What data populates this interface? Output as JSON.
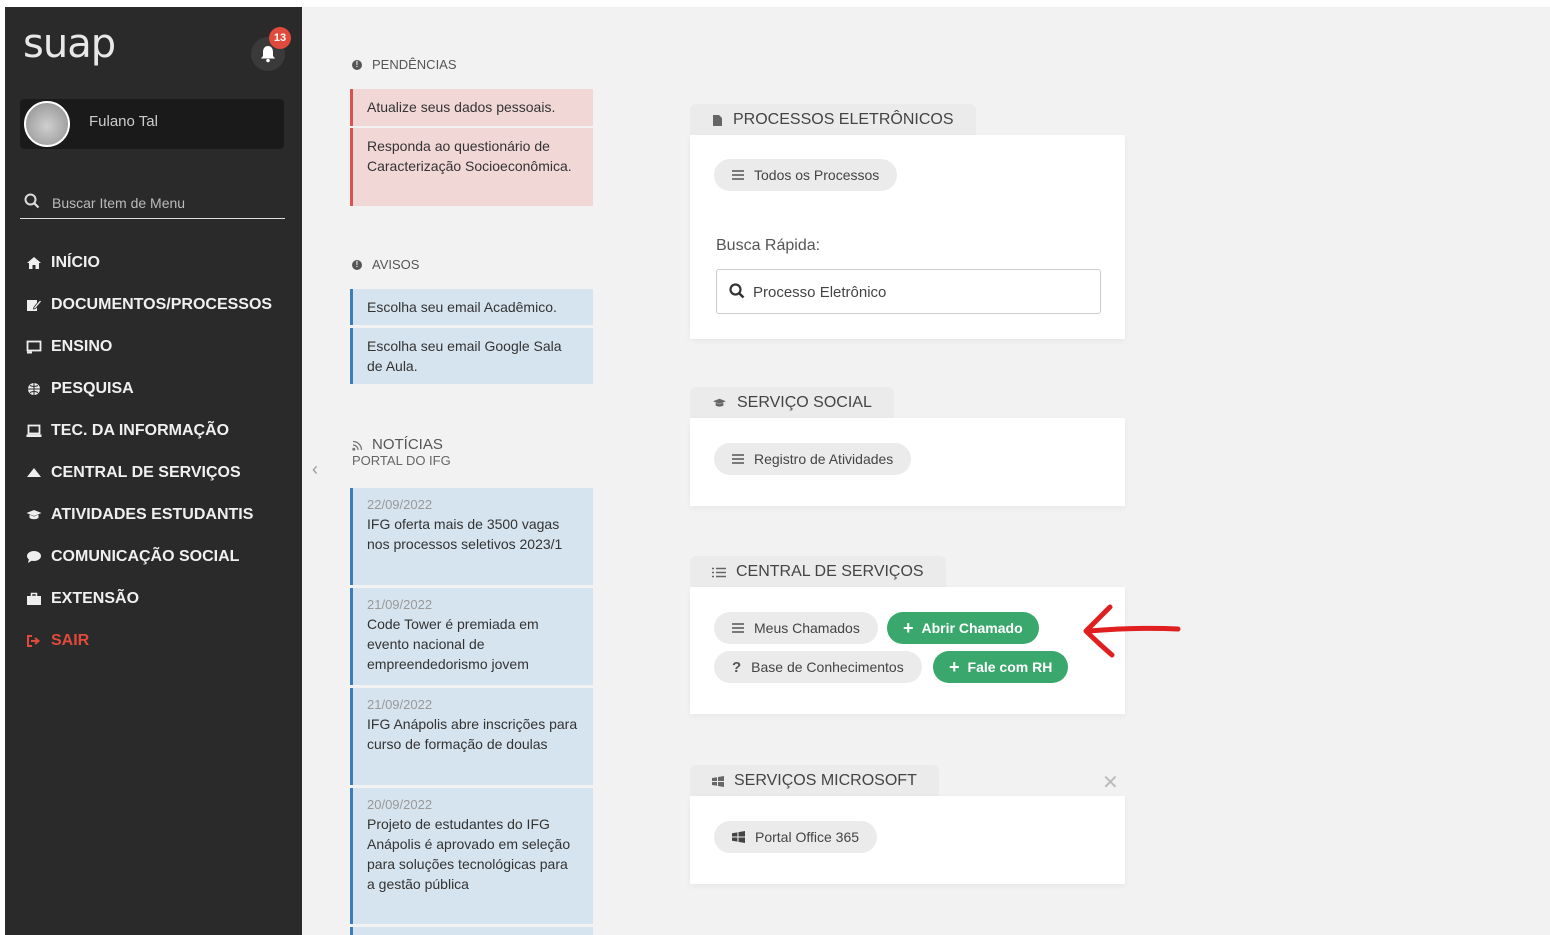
{
  "app": {
    "logo": "suap",
    "notification_count": "13",
    "user_name": "Fulano Tal"
  },
  "sidebar": {
    "search_placeholder": "Buscar Item de Menu",
    "items": [
      {
        "label": "INÍCIO",
        "icon": "home-icon"
      },
      {
        "label": "DOCUMENTOS/PROCESSOS",
        "icon": "edit-icon"
      },
      {
        "label": "ENSINO",
        "icon": "chalkboard-icon"
      },
      {
        "label": "PESQUISA",
        "icon": "globe-icon"
      },
      {
        "label": "TEC. DA INFORMAÇÃO",
        "icon": "laptop-icon"
      },
      {
        "label": "CENTRAL DE SERVIÇOS",
        "icon": "eject-icon"
      },
      {
        "label": "ATIVIDADES ESTUDANTIS",
        "icon": "graduation-cap-icon"
      },
      {
        "label": "COMUNICAÇÃO SOCIAL",
        "icon": "comment-icon"
      },
      {
        "label": "EXTENSÃO",
        "icon": "briefcase-icon"
      },
      {
        "label": "SAIR",
        "icon": "sign-out-icon"
      }
    ]
  },
  "pendencias": {
    "title": "PENDÊNCIAS",
    "items": [
      "Atualize seus dados pessoais.",
      "Responda ao questionário de Caracterização Socioeconômica."
    ]
  },
  "avisos": {
    "title": "AVISOS",
    "items": [
      "Escolha seu email Acadêmico.",
      "Escolha seu email Google Sala de Aula."
    ]
  },
  "noticias": {
    "title": "NOTÍCIAS",
    "subtitle": "PORTAL DO IFG",
    "items": [
      {
        "date": "22/09/2022",
        "text": "IFG oferta mais de 3500 vagas nos processos seletivos 2023/1"
      },
      {
        "date": "21/09/2022",
        "text": "Code Tower é premiada em evento nacional de empreendedorismo jovem"
      },
      {
        "date": "21/09/2022",
        "text": "IFG Anápolis abre inscrições para curso de formação de doulas"
      },
      {
        "date": "20/09/2022",
        "text": "Projeto de estudantes do IFG Anápolis é aprovado em seleção para soluções tecnológicas para a gestão pública"
      }
    ]
  },
  "processos": {
    "title": "PROCESSOS ELETRÔNICOS",
    "all_button": "Todos os Processos",
    "quick_label": "Busca Rápida:",
    "quick_placeholder": "Processo Eletrônico"
  },
  "servico_social": {
    "title": "SERVIÇO SOCIAL",
    "button": "Registro de Atividades"
  },
  "central": {
    "title": "CENTRAL DE SERVIÇOS",
    "meus_chamados": "Meus Chamados",
    "abrir_chamado": "Abrir Chamado",
    "base_conhecimentos": "Base de Conhecimentos",
    "fale_rh": "Fale com RH"
  },
  "microsoft": {
    "title": "SERVIÇOS MICROSOFT",
    "button": "Portal Office 365"
  },
  "colors": {
    "sidebar_bg": "#2a2a2a",
    "accent_green": "#3aa76d",
    "danger": "#e04a3c",
    "annotation_arrow": "#e02020"
  }
}
